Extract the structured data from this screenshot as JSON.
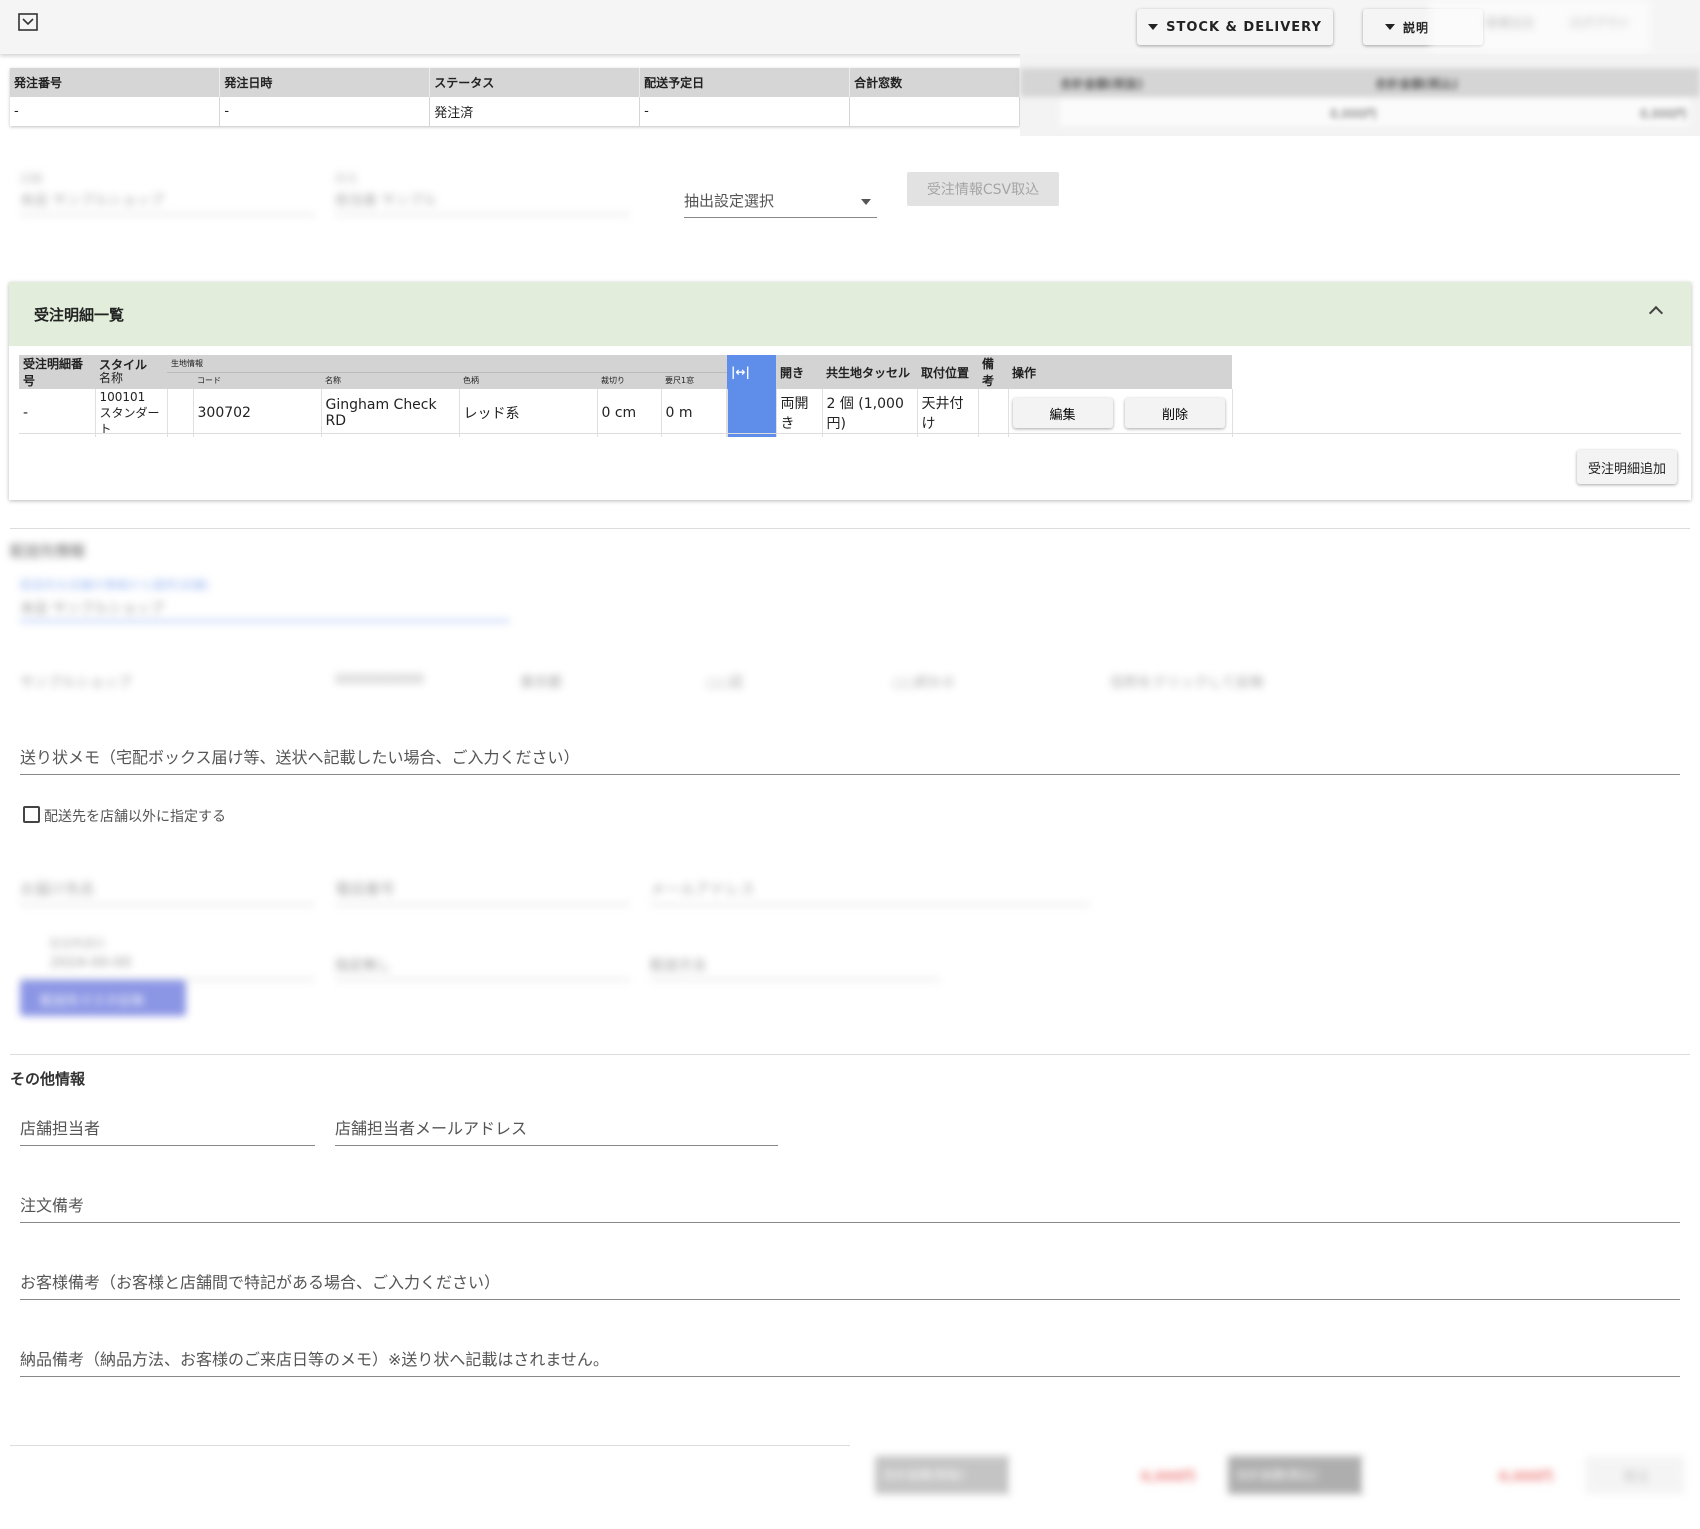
{
  "topbar": {
    "menu_icon": "check-box-icon",
    "stock_delivery_label": "STOCK & DELIVERY",
    "explain_label": "説明",
    "blurred_right_1": "新規注文",
    "blurred_right_2": "ログアウト"
  },
  "order_summary": {
    "headers": [
      "発注番号",
      "発注日時",
      "ステータス",
      "配送予定日",
      "合計窓数"
    ],
    "row": [
      "-",
      "-",
      "発注済",
      "-",
      ""
    ],
    "blurred_headers": [
      "合計金額(税抜)",
      "合計金額(税込)"
    ],
    "blurred_values": [
      "0,000円",
      "0,000円"
    ]
  },
  "filters": {
    "blurred_field_1_label": "店舗",
    "blurred_field_1_value": "本店 サンプルショップ",
    "blurred_field_2_label": "担当",
    "blurred_field_2_value": "担当者 サンプル",
    "extract_setting_label": "抽出設定選択",
    "csv_import_label": "受注情報CSV取込"
  },
  "details_panel": {
    "title": "受注明細一覧",
    "columns": {
      "detail_no": "受注明細番号",
      "style": "スタイル",
      "style_sub": "名称",
      "fabric_group": "生地情報",
      "code": "コード",
      "name": "名称",
      "color": "色柄",
      "cut": "裁切り",
      "length": "要尺1窓",
      "opening": "開き",
      "tassel": "共生地タッセル",
      "mount": "取付位置",
      "remarks": "備考",
      "actions": "操作"
    },
    "rows": [
      {
        "detail_no": "-",
        "style_code": "100101",
        "style_name": "スタンダート",
        "code": "300702",
        "name": "Gingham Check RD",
        "color": "レッド系",
        "cut": "0 cm",
        "length": "0 m",
        "opening": "両開き",
        "tassel": "2 個 (1,000 円)",
        "mount": "天井付け",
        "remarks": "",
        "edit_label": "編集",
        "delete_label": "削除"
      }
    ],
    "expand_icon": "expand-horizontal-icon",
    "add_label": "受注明細追加"
  },
  "delivery": {
    "blurred_title": "配送先情報",
    "blurred_select_label": "配送先を店舗の情報から選択(店舗)",
    "blurred_select_value": "本店 サンプルショップ",
    "blurred_info": [
      "サンプルショップ",
      "0000000000",
      "東京都",
      "○○区",
      "○○町0-0",
      "住所をクリックして反映"
    ],
    "invoice_memo_placeholder": "送り状メモ（宅配ボックス届け等、送状へ記載したい場合、ご入力ください）",
    "checkbox_label": "配送先を店舗以外に指定する",
    "blurred_fields": [
      "お届け先名",
      "電話番号",
      "メールアドレス"
    ],
    "blurred_date_label": "配送希望日",
    "blurred_date_value": "2024-00-00",
    "blurred_time_value": "指定無し",
    "blurred_method_value": "配送方法",
    "blurred_button_label": "配送先マスタ反映"
  },
  "other_info": {
    "title": "その他情報",
    "staff_placeholder": "店舗担当者",
    "staff_email_placeholder": "店舗担当者メールアドレス",
    "order_note_placeholder": "注文備考",
    "customer_note_placeholder": "お客様備考（お客様と店舗間で特記がある場合、ご入力ください）",
    "delivery_note_placeholder": "納品備考（納品方法、お客様のご来店日等のメモ）※送り状へ記載はされません。"
  },
  "footer": {
    "blurred_label_1": "合計金額(税抜)",
    "blurred_value_1": "0,000円",
    "blurred_label_2": "合計金額(税込)",
    "blurred_value_2": "0,000円",
    "blurred_button": "発注"
  },
  "colors": {
    "panel_header_bg": "#e2eedb",
    "expand_cell_bg": "#5e8dea",
    "blue_button": "#3f51d4",
    "price_red": "#e53935"
  }
}
